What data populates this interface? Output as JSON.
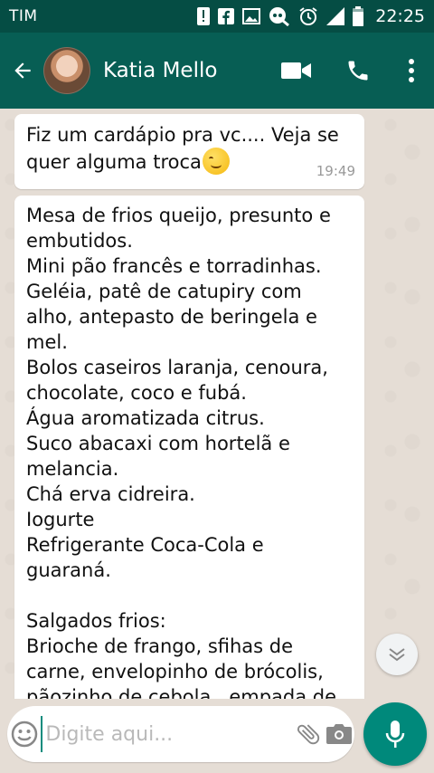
{
  "status_bar": {
    "carrier": "TIM",
    "time": "22:25",
    "icons": [
      "alert-icon",
      "facebook-icon",
      "image-icon",
      "game-icon",
      "alarm-icon",
      "signal-icon",
      "battery-icon"
    ]
  },
  "header": {
    "contact_name": "Katia Mello",
    "icons": [
      "back-arrow-icon",
      "video-call-icon",
      "phone-icon",
      "more-vert-icon"
    ]
  },
  "messages": [
    {
      "text": "Fiz um cardápio pra vc.... Veja se quer alguma troca",
      "emoji": "smirk-emoji",
      "time": "19:49"
    },
    {
      "text": "Mesa de frios queijo, presunto e embutidos.\nMini pão francês e torradinhas.\nGeléia, patê de catupiry com alho, antepasto de beringela e mel.\nBolos caseiros laranja, cenoura, chocolate, coco e fubá.\nÁgua aromatizada citrus.\nSuco abacaxi com hortelã e melancia.\nChá erva cidreira.\nIogurte\nRefrigerante Coca-Cola e guaraná.\n\nSalgados frios:\nBrioche de frango, sfihas de carne, envelopinho de brócolis, pãozinho de cebola,  empada de palmito , canapés de ervas finas e"
    }
  ],
  "composer": {
    "placeholder": "Digite aqui...",
    "value": "",
    "icons": [
      "emoji-icon",
      "attach-icon",
      "camera-icon",
      "mic-icon"
    ]
  },
  "colors": {
    "status_bar": "#054d44",
    "app_bar": "#075e54",
    "accent": "#00897b",
    "chat_bg": "#e5ddd5"
  }
}
